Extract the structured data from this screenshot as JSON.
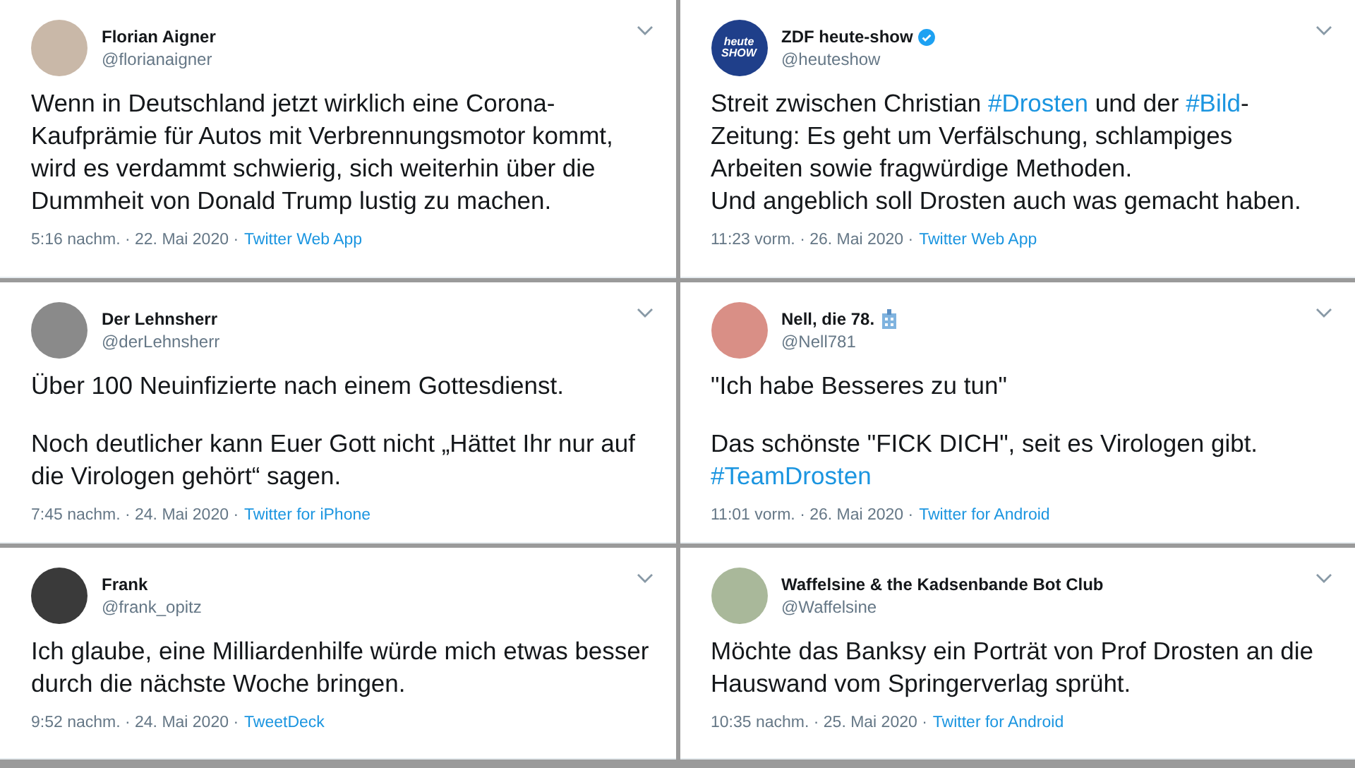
{
  "tweets": [
    {
      "name": "Florian Aigner",
      "handle": "@florianaigner",
      "verified": false,
      "building_icon": false,
      "avatar": {
        "kind": "photo",
        "color": "#c9b8a8"
      },
      "paragraphs": [
        [
          {
            "kind": "text",
            "text": "Wenn in Deutschland jetzt wirklich eine Corona-Kaufprämie für Autos mit Verbrennungsmotor kommt, wird es verdammt schwierig, sich weiterhin über die Dummheit von Donald Trump lustig zu machen."
          }
        ]
      ],
      "timestamp": "5:16 nachm. · 22. Mai 2020 ·",
      "source": "Twitter Web App"
    },
    {
      "name": "ZDF heute-show",
      "handle": "@heuteshow",
      "verified": true,
      "building_icon": false,
      "avatar": {
        "kind": "logo",
        "text": "heute SHOW",
        "color": "#1f3f8a"
      },
      "paragraphs": [
        [
          {
            "kind": "text",
            "text": "Streit zwischen Christian "
          },
          {
            "kind": "hashtag",
            "text": "#Drosten"
          },
          {
            "kind": "text",
            "text": " und der "
          },
          {
            "kind": "hashtag",
            "text": "#Bild"
          },
          {
            "kind": "text",
            "text": "-Zeitung: Es geht um Verfälschung, schlampiges Arbeiten sowie fragwürdige Methoden."
          }
        ],
        [
          {
            "kind": "text",
            "text": "Und angeblich soll Drosten auch was gemacht haben."
          }
        ]
      ],
      "tight": true,
      "timestamp": "11:23 vorm. · 26. Mai 2020 ·",
      "source": "Twitter Web App"
    },
    {
      "name": "Der Lehnsherr",
      "handle": "@derLehnsherr",
      "verified": false,
      "building_icon": false,
      "avatar": {
        "kind": "photo",
        "color": "#8a8a8a"
      },
      "paragraphs": [
        [
          {
            "kind": "text",
            "text": "Über 100 Neuinfizierte nach einem Gottesdienst."
          }
        ],
        [
          {
            "kind": "text",
            "text": "Noch deutlicher kann Euer Gott nicht „Hättet Ihr nur auf die Virologen gehört“ sagen."
          }
        ]
      ],
      "tight": false,
      "timestamp": "7:45 nachm. · 24. Mai 2020 ·",
      "source": "Twitter for iPhone"
    },
    {
      "name": "Nell, die 78.",
      "handle": "@Nell781",
      "verified": false,
      "building_icon": true,
      "avatar": {
        "kind": "photo",
        "color": "#d98f86"
      },
      "paragraphs": [
        [
          {
            "kind": "text",
            "text": "\"Ich habe Besseres zu tun\""
          }
        ],
        [
          {
            "kind": "text",
            "text": "Das schönste \"FICK DICH\",  seit es Virologen gibt. "
          },
          {
            "kind": "hashtag",
            "text": "#TeamDrosten"
          }
        ]
      ],
      "tight": false,
      "timestamp": "11:01 vorm. · 26. Mai 2020 ·",
      "source": "Twitter for Android"
    },
    {
      "name": "Frank",
      "handle": "@frank_opitz",
      "verified": false,
      "building_icon": false,
      "avatar": {
        "kind": "photo",
        "color": "#3a3a3a"
      },
      "paragraphs": [
        [
          {
            "kind": "text",
            "text": "Ich glaube, eine Milliardenhilfe würde mich etwas besser durch die nächste Woche bringen."
          }
        ]
      ],
      "timestamp": "9:52 nachm. · 24. Mai 2020 ·",
      "source": "TweetDeck"
    },
    {
      "name": "Waffelsine & the Kadsenbande Bot Club",
      "handle": "@Waffelsine",
      "verified": false,
      "building_icon": false,
      "avatar": {
        "kind": "photo",
        "color": "#a9b89a"
      },
      "paragraphs": [
        [
          {
            "kind": "text",
            "text": "Möchte das Banksy ein Porträt von Prof Drosten an die Hauswand vom Springerverlag sprüht."
          }
        ]
      ],
      "timestamp": "10:35 nachm. · 25. Mai 2020 ·",
      "source": "Twitter for Android"
    }
  ]
}
